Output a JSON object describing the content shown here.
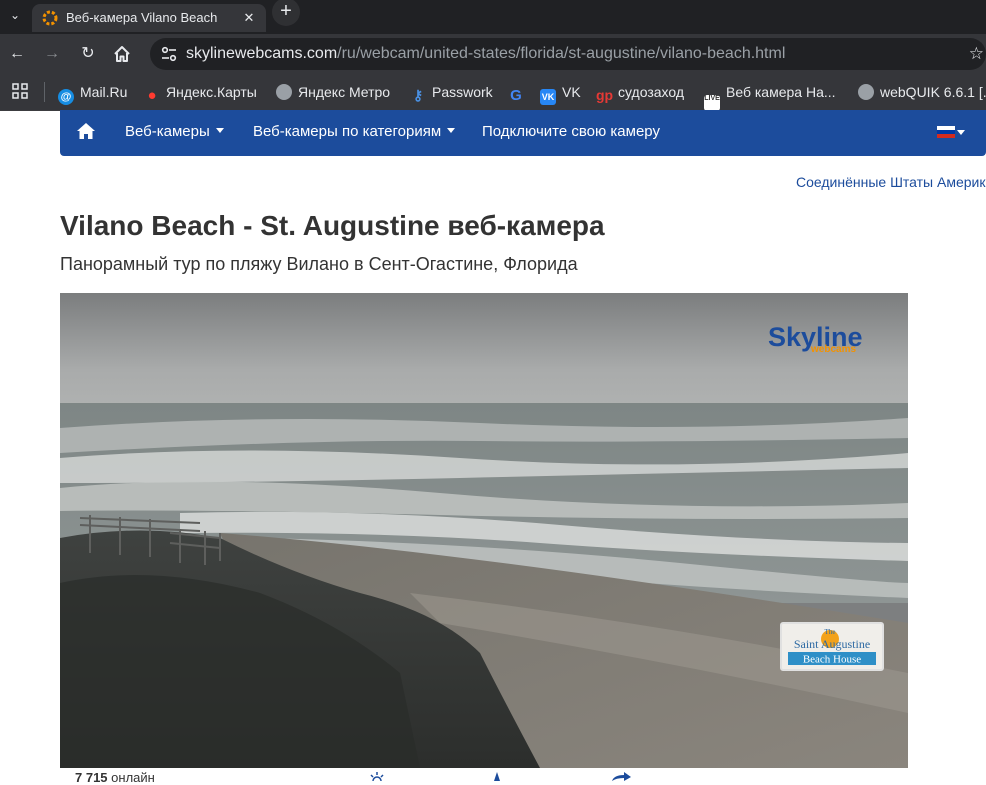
{
  "browser": {
    "tab_title": "Веб-камера Vilano Beach",
    "url_host": "skylinewebcams.com",
    "url_path": "/ru/webcam/united-states/florida/st-augustine/vilano-beach.html",
    "bookmarks": [
      {
        "label": "Mail.Ru",
        "icon": "mailru-icon",
        "color": "#168de2"
      },
      {
        "label": "Яндекс.Карты",
        "icon": "map-pin-icon",
        "color": "#ff3b30"
      },
      {
        "label": "Яндекс Метро",
        "icon": "globe-icon",
        "color": "#9aa0a6"
      },
      {
        "label": "Passwork",
        "icon": "key-icon",
        "color": "#4a90e2"
      },
      {
        "label": "",
        "icon": "google-icon",
        "color": "#4285f4"
      },
      {
        "label": "VK",
        "icon": "vk-icon",
        "color": "#2787f5"
      },
      {
        "label": "судозаход",
        "icon": "gp-icon",
        "color": "#e53935"
      },
      {
        "label": "Веб камера На...",
        "icon": "live-icon",
        "color": "#ffffff"
      },
      {
        "label": "webQUIK 6.6.1 [...",
        "icon": "globe-icon",
        "color": "#9aa0a6"
      }
    ]
  },
  "nav": {
    "webcams": "Веб-камеры",
    "categories": "Веб-камеры по категориям",
    "connect": "Подключите свою камеру"
  },
  "breadcrumb": {
    "country": "Соединённые Штаты Америки"
  },
  "page": {
    "title": "Vilano Beach - St. Augustine веб-камера",
    "subtitle": "Панорамный тур по пляжу Вилано в Сент-Огастине, Флорида"
  },
  "player": {
    "brand": "Skyline",
    "brand_sub": "webcams",
    "sponsor_line1": "The",
    "sponsor_line2": "Saint Augustine",
    "sponsor_line3": "Beach House"
  },
  "stats": {
    "online_count": "7 715",
    "online_label": "онлайн"
  },
  "colors": {
    "nav_blue": "#1c4c9c",
    "brand_blue": "#1c4c9c",
    "brand_orange": "#f39200"
  }
}
